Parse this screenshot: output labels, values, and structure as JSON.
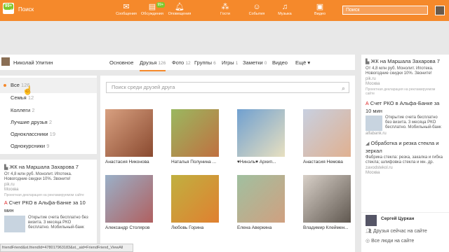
{
  "topbar": {
    "logo_badge": "99+",
    "back_label": "Поиск",
    "nav": [
      {
        "label": "Сообщения",
        "icon": "message-icon",
        "badge": ""
      },
      {
        "label": "Обсуждения",
        "icon": "discussion-icon",
        "badge": "99+"
      },
      {
        "label": "Оповещения",
        "icon": "bell-icon",
        "badge": ""
      },
      {
        "label": "Гости",
        "icon": "footprints-icon",
        "badge": ""
      },
      {
        "label": "События",
        "icon": "events-icon",
        "badge": ""
      },
      {
        "label": "Музыка",
        "icon": "music-icon",
        "badge": ""
      },
      {
        "label": "Видео",
        "icon": "video-icon",
        "badge": ""
      }
    ],
    "search_placeholder": "Поиск"
  },
  "profile": {
    "name": "Николай Улитин",
    "tabs": [
      {
        "label": "Основное",
        "count": ""
      },
      {
        "label": "Друзья",
        "count": "126"
      },
      {
        "label": "Фото",
        "count": "12"
      },
      {
        "label": "Группы",
        "count": "6"
      },
      {
        "label": "Игры",
        "count": "1"
      },
      {
        "label": "Заметки",
        "count": "0"
      },
      {
        "label": "Видео",
        "count": ""
      },
      {
        "label": "Ещё ▾",
        "count": ""
      }
    ]
  },
  "friend_filters": [
    {
      "label": "Все",
      "count": "126"
    },
    {
      "label": "Семья",
      "count": "12"
    },
    {
      "label": "Коллеги",
      "count": "2"
    },
    {
      "label": "Лучшие друзья",
      "count": "2"
    },
    {
      "label": "Одноклассники",
      "count": "19"
    },
    {
      "label": "Однокурсники",
      "count": "9"
    }
  ],
  "friend_search_placeholder": "Поиск среди друзей друга",
  "friends": [
    {
      "name": "Анастасия Никонова",
      "color": "#c07a5a"
    },
    {
      "name": "Наталья Полунина ...",
      "color": "#7a9a4a"
    },
    {
      "name": "♥Нинэль♥ Архип...",
      "color": "#6a8ab0"
    },
    {
      "name": "Анастасия Немова",
      "color": "#a8b4c8"
    },
    {
      "name": "Александр Столяров",
      "color": "#8aa0b8"
    },
    {
      "name": "Любовь Горина",
      "color": "#a0a050"
    },
    {
      "name": "Елена Аверкина",
      "color": "#90a890"
    },
    {
      "name": "Владимир Клеймен...",
      "color": "#c8c0b8"
    }
  ],
  "left_ads": [
    {
      "title": "ЖК на Маршала Захарова 7",
      "text": "От 4,8 млн руб. Монолит. Ипотека. Новогодние скидки 10%. Звоните!",
      "host": "pik.ru",
      "city": "Москва",
      "decl": "Проектная декларация на рекламируемом сайте"
    },
    {
      "title": "Счет РКО в Альфа-Банке за 10 мин",
      "text": "Открытие счета бесплатно без визита. 3 месяца РКО бесплатно. Мобильный-банк"
    }
  ],
  "right_ads": [
    {
      "title": "ЖК на Маршала Захарова 7",
      "text": "От 4,8 млн руб. Монолит. Ипотека. Новогодние скидки 10%. Звоните!",
      "host": "pik.ru",
      "city": "Москва",
      "decl": "Проектная декларация на рекламируемом сайте"
    },
    {
      "title": "Счет РКО в Альфа-Банке за 10 мин",
      "text": "Открытие счета бесплатно без визита. 3 месяца РКО бесплатно. Мобильный-банк",
      "host": "alfabank.ru"
    },
    {
      "title": "Обработка и резка стекла и зеркал",
      "text": "Фабрика стекла: резка, закалка и гибка стекла; шлифовка стекла и мн. др.",
      "host": "zavodstekol.ru",
      "city": "Москва"
    }
  ],
  "right_user": {
    "name": "Сергей Цуркан",
    "online_link": "Друзья сейчас на сайте",
    "all_link": "Все люди на сайте"
  },
  "status_url": "friendFriend&st.friendId=478017963183&st._aid=FriendFriend_ViewAll",
  "colors": {
    "accent": "#f5892b",
    "badge": "#7ec82c"
  }
}
